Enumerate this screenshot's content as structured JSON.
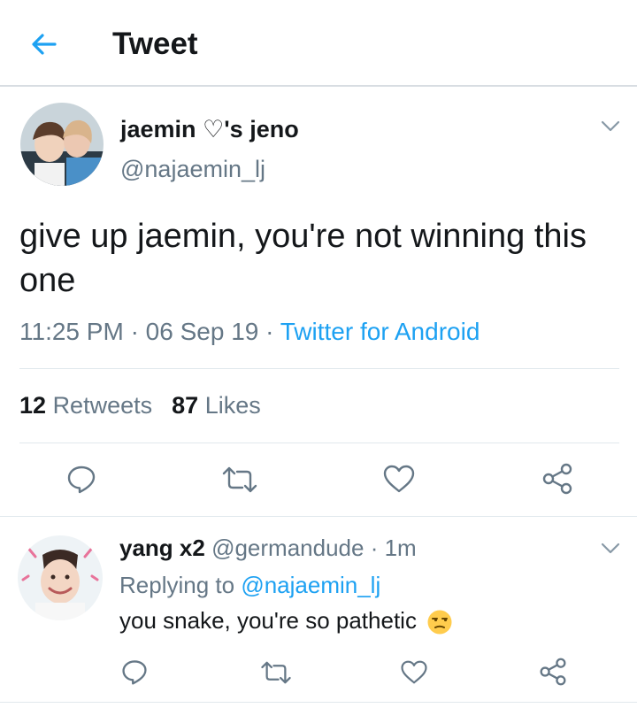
{
  "header": {
    "title": "Tweet"
  },
  "tweet": {
    "display_name_before": "jaemin ",
    "display_name_heart": "♡",
    "display_name_after": "'s jeno",
    "handle": "@najaemin_lj",
    "text": "give up jaemin, you're not winning this one",
    "time": "11:25 PM",
    "date": "06 Sep 19",
    "separator": "·",
    "source": "Twitter for Android",
    "retweets_count": "12",
    "retweets_label": "Retweets",
    "likes_count": "87",
    "likes_label": "Likes"
  },
  "reply": {
    "display_name": "yang x2",
    "handle": "@germandude",
    "separator": "·",
    "time_ago": "1m",
    "replying_to_label": "Replying to",
    "replying_to_mention": "@najaemin_lj",
    "text": "you snake, you're so pathetic",
    "emoji": "unamused-face"
  },
  "icons": {
    "back": "back-arrow-icon",
    "more": "chevron-down-icon",
    "reply": "reply-icon",
    "retweet": "retweet-icon",
    "like": "heart-icon",
    "share": "share-icon"
  },
  "colors": {
    "accent": "#1da1f2",
    "text_primary": "#14171a",
    "text_secondary": "#657786",
    "divider": "#e1e8ed"
  }
}
